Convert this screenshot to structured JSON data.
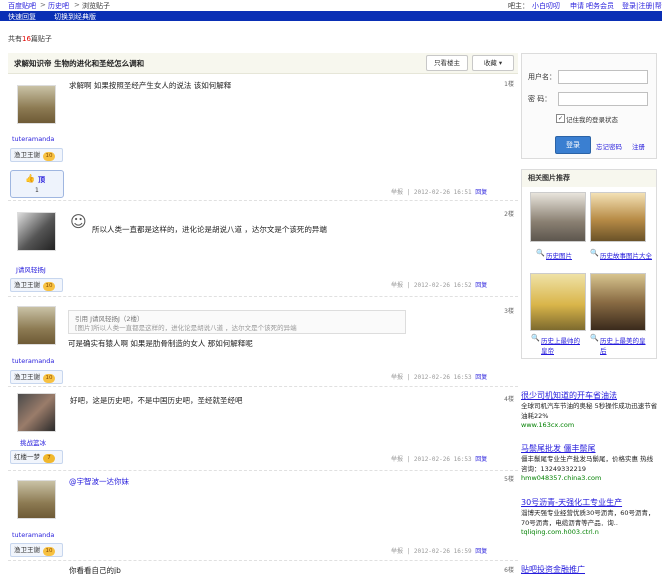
{
  "breadcrumb": {
    "home": "百度贴吧",
    "forum": "历史吧",
    "sep": ">",
    "page": "浏览贴子"
  },
  "topright": {
    "owner_label": "吧主：",
    "owner": "小白叨叨",
    "apply": "申请",
    "apply2": "吧务会员",
    "login": "登录|注册|帮助"
  },
  "bluebar": {
    "quick_reply": "快速回复",
    "switch_classic": "切换到经典版"
  },
  "summary": {
    "prefix": "共有",
    "count": "16",
    "suffix": "篇贴子"
  },
  "post_title": "求解知识帝  生物的进化和圣经怎么调和",
  "buttons": {
    "only_owner": "只看楼主",
    "collect": "收藏"
  },
  "ding": {
    "label": "顶",
    "count": "1"
  },
  "posts": [
    {
      "floor": "1楼",
      "user": "tuteramanda",
      "level_name": "渔卫王谢",
      "level": "10",
      "content": "求解啊  如果按照圣经产生女人的说法  该如何解释",
      "report": "举报",
      "time": "2012-02-26 16:51",
      "reply": "回复"
    },
    {
      "floor": "2楼",
      "user": "J请风轻扬J",
      "level_name": "渔卫王谢",
      "level": "10",
      "content": "所以人类一直都是这样的，进化论是胡说八道  ，达尔文是个该死的异端",
      "report": "举报",
      "time": "2012-02-26 16:52",
      "reply": "回复"
    },
    {
      "floor": "3楼",
      "user": "tuteramanda",
      "level_name": "渔卫王谢",
      "level": "10",
      "quote_head": "引用  J请风轻扬J（2楼）",
      "quote_body": "[图片]所以人类一直都是这样的，进化论是胡说八道  ，达尔文是个该死的异端",
      "content": "可是确实有猿人啊  如果是肋骨制造的女人  那如何解释呢",
      "report": "举报",
      "time": "2012-02-26 16:53",
      "reply": "回复"
    },
    {
      "floor": "4楼",
      "user": "挑战篮冰",
      "level_name": "红楼一梦",
      "level": "7",
      "content": "好吧，这是历史吧，不是中国历史吧，圣经就圣经吧",
      "report": "举报",
      "time": "2012-02-26 16:53",
      "reply": "回复"
    },
    {
      "floor": "5楼",
      "user": "tuteramanda",
      "level_name": "渔卫王谢",
      "level": "10",
      "content": "@宇智波一达你妹",
      "report": "举报",
      "time": "2012-02-26 16:59",
      "reply": "回复"
    },
    {
      "floor": "6楼",
      "content": "你看看自己的jb"
    }
  ],
  "login": {
    "username_label": "用户名：",
    "password_label": "密    码：",
    "remember": "记住我的登录状态",
    "login_btn": "登录",
    "forgot": "忘记密码",
    "register": "注册"
  },
  "pics": {
    "title": "相关图片推荐",
    "items": [
      {
        "caption": "历史图片"
      },
      {
        "caption": "历史故事图片大全"
      },
      {
        "caption": "历史上最帅的皇帝"
      },
      {
        "caption": "历史上最美的皇后"
      }
    ]
  },
  "ads": [
    {
      "title": "很少司机知道的开车省油法",
      "desc": "全球司机汽车节油的奥秘  5秒操作成功迅速节省油耗22%",
      "url": "www.163cx.com"
    },
    {
      "title": "马鬃尾批发  僵丰鬃尾",
      "desc": "僵丰鬃尾专业生产批发马鬃尾，价格实惠  热线咨询：13249332219",
      "url": "hmw048357.china3.com"
    },
    {
      "title": "30号沥青-天强化工专业生产",
      "desc": "淄博天强专业经营优质30号沥青，60号沥青，70号沥青，电缆沥青等产品．询..",
      "url": "tqliqing.com.h003.ctrl.n"
    },
    {
      "title": "贴吧投资金融推广"
    }
  ]
}
